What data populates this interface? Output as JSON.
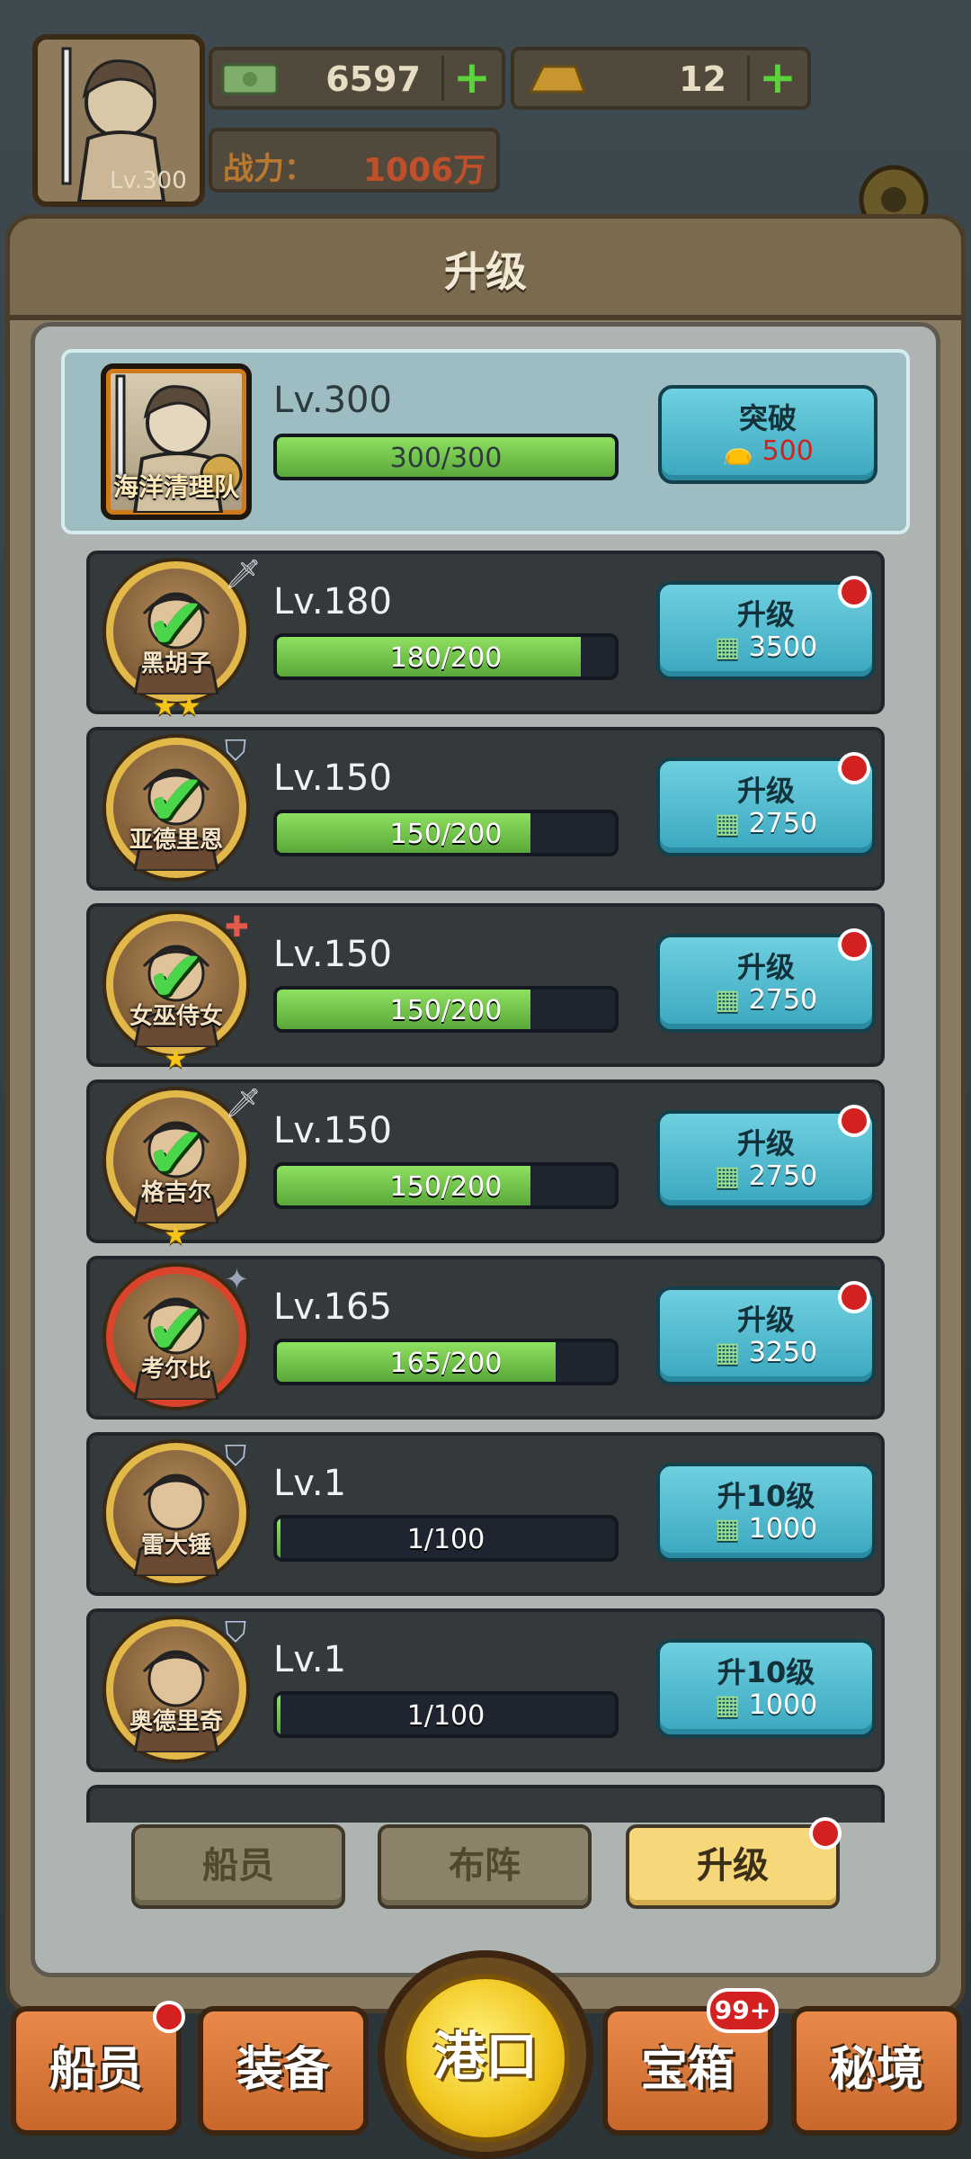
{
  "header": {
    "player_level": "Lv.300",
    "cash": "6597",
    "gold": "12",
    "power_label": "战力：",
    "power_value": "1006万"
  },
  "panel": {
    "title": "升级"
  },
  "leader": {
    "name": "海洋清理队",
    "level": "Lv.300",
    "progress_text": "300/300",
    "progress": 1.0,
    "button_label": "突破",
    "button_cost": "500"
  },
  "crew": [
    {
      "name": "黑胡子",
      "level": "Lv.180",
      "progress_text": "180/200",
      "progress": 0.9,
      "button_label": "升级",
      "cost": "3500",
      "stars": "★★",
      "class_icon": "sword-icon",
      "checked": true,
      "notify": true
    },
    {
      "name": "亚德里恩",
      "level": "Lv.150",
      "progress_text": "150/200",
      "progress": 0.75,
      "button_label": "升级",
      "cost": "2750",
      "stars": "",
      "class_icon": "shield-icon",
      "checked": true,
      "notify": true
    },
    {
      "name": "女巫侍女",
      "level": "Lv.150",
      "progress_text": "150/200",
      "progress": 0.75,
      "button_label": "升级",
      "cost": "2750",
      "stars": "★",
      "class_icon": "heal-cross-icon",
      "checked": true,
      "notify": true
    },
    {
      "name": "格吉尔",
      "level": "Lv.150",
      "progress_text": "150/200",
      "progress": 0.75,
      "button_label": "升级",
      "cost": "2750",
      "stars": "★",
      "class_icon": "sword-icon",
      "checked": true,
      "notify": true
    },
    {
      "name": "考尔比",
      "level": "Lv.165",
      "progress_text": "165/200",
      "progress": 0.825,
      "button_label": "升级",
      "cost": "3250",
      "stars": "",
      "class_icon": "shuriken-icon",
      "checked": true,
      "notify": true
    },
    {
      "name": "雷大锤",
      "level": "Lv.1",
      "progress_text": "1/100",
      "progress": 0.01,
      "button_label": "升10级",
      "cost": "1000",
      "stars": "",
      "class_icon": "shield-icon",
      "checked": false,
      "notify": false
    },
    {
      "name": "奥德里奇",
      "level": "Lv.1",
      "progress_text": "1/100",
      "progress": 0.01,
      "button_label": "升10级",
      "cost": "1000",
      "stars": "",
      "class_icon": "shield-icon",
      "checked": false,
      "notify": false
    }
  ],
  "tabs": [
    {
      "label": "船员",
      "active": false
    },
    {
      "label": "布阵",
      "active": false
    },
    {
      "label": "升级",
      "active": true
    }
  ],
  "bottom_nav": {
    "crew": "船员",
    "equipment": "装备",
    "port": "港口",
    "chest": "宝箱",
    "chest_badge": "99+",
    "secret": "秘境"
  }
}
